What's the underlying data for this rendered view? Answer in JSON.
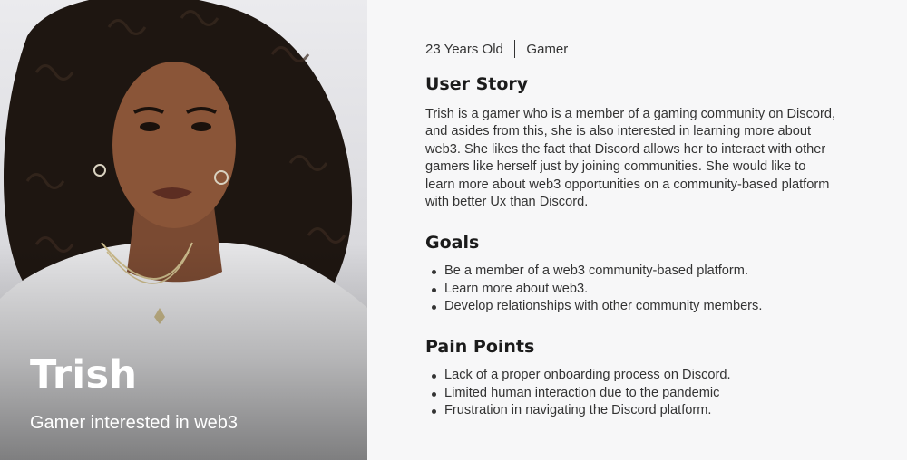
{
  "persona": {
    "name": "Trish",
    "tagline": "Gamer interested in web3"
  },
  "meta": {
    "age": "23 Years Old",
    "occupation": "Gamer"
  },
  "user_story": {
    "heading": "User Story",
    "text": "Trish is a gamer who is a member of a gaming community on Discord, and asides from this, she is also interested in learning more about web3. She likes the fact that Discord allows her to interact with other gamers like herself just by joining communities. She would like to learn more about web3 opportunities on a community-based platform with better Ux than Discord."
  },
  "goals": {
    "heading": "Goals",
    "items": [
      "Be a member of a web3 community-based platform.",
      "Learn more about web3.",
      "Develop relationships with other community members."
    ]
  },
  "pain_points": {
    "heading": "Pain Points",
    "items": [
      "Lack of a proper onboarding process on Discord.",
      "Limited human interaction due to the pandemic",
      "Frustration in navigating the Discord platform."
    ]
  },
  "colors": {
    "page_background": "#f7f7f8",
    "text": "#333333",
    "heading": "#1b1b1b",
    "overlay_text": "#ffffff"
  }
}
